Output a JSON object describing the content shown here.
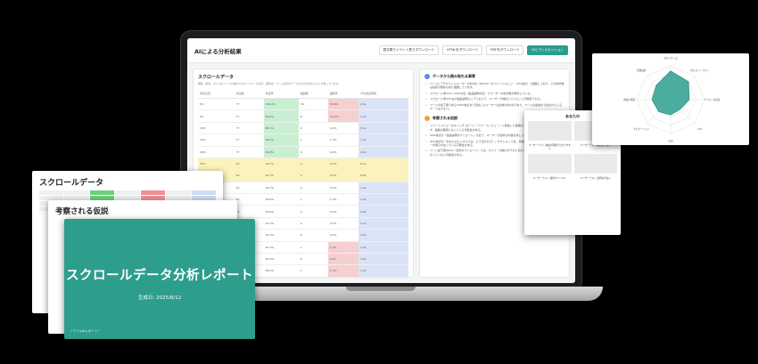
{
  "app": {
    "title": "AIによる分析結果",
    "buttons": [
      {
        "label": "週次周りイベント表でダウンロード"
      },
      {
        "label": "HTMLをダウンロード"
      },
      {
        "label": "PDFをダウンロード"
      },
      {
        "label": "AIとディスカッション"
      }
    ]
  },
  "left_panel": {
    "title": "スクロールデータ",
    "subtitle": "概要、指標、ボトルポイントFV等のスクロールバーの表示、閲覧率、ページ表示率データからの比率をさらに分析しています。",
    "columns": [
      "到達位置",
      "到達数",
      "到達率",
      "離脱数",
      "離脱率",
      "平均滞在時間"
    ],
    "rows": [
      {
        "pos": "0%",
        "count": "77",
        "rate": "100.0%",
        "exit": "39",
        "exit_rate": "50.6%",
        "time": "4.5s",
        "rate_c": "g",
        "exit_c": "r",
        "hl": false
      },
      {
        "pos": "5%",
        "count": "77",
        "rate": "50.6%",
        "exit": "8",
        "exit_rate": "10.4%",
        "time": "2.1s",
        "rate_c": "g",
        "exit_c": "r",
        "hl": false
      },
      {
        "pos": "10%",
        "count": "77",
        "rate": "48.1%",
        "exit": "0",
        "exit_rate": "0.0%",
        "time": "5.1s",
        "rate_c": "g",
        "exit_c": "",
        "hl": false
      },
      {
        "pos": "15%",
        "count": "77",
        "rate": "48.1%",
        "exit": "1",
        "exit_rate": "1.3%",
        "time": "7.1s",
        "rate_c": "g",
        "exit_c": "",
        "hl": false
      },
      {
        "pos": "20%",
        "count": "77",
        "rate": "46.8%",
        "exit": "0",
        "exit_rate": "0.0%",
        "time": "4.2s",
        "rate_c": "g",
        "exit_c": "",
        "hl": false
      },
      {
        "pos": "25%",
        "count": "16",
        "rate": "44.7%",
        "exit": "0",
        "exit_rate": "0.7%",
        "time": "8.1s",
        "rate_c": "g",
        "exit_c": "",
        "hl": true
      },
      {
        "pos": "30%",
        "count": "16",
        "rate": "44.7%",
        "exit": "0",
        "exit_rate": "0.7%",
        "time": "8.8s",
        "rate_c": "g",
        "exit_c": "",
        "hl": true
      },
      {
        "pos": "35%",
        "count": "16",
        "rate": "44.7%",
        "exit": "0",
        "exit_rate": "0.0%",
        "time": "1.2s",
        "rate_c": "",
        "exit_c": "",
        "hl": false
      },
      {
        "pos": "40%",
        "count": "16",
        "rate": "43.6%",
        "exit": "1",
        "exit_rate": "1.3%",
        "time": "2.4s",
        "rate_c": "",
        "exit_c": "",
        "hl": false
      },
      {
        "pos": "45%",
        "count": "16",
        "rate": "43.6%",
        "exit": "0",
        "exit_rate": "0.0%",
        "time": "2.8s",
        "rate_c": "",
        "exit_c": "",
        "hl": false
      },
      {
        "pos": "50%",
        "count": "16",
        "rate": "42.3%",
        "exit": "0",
        "exit_rate": "0.0%",
        "time": "4.1s",
        "rate_c": "",
        "exit_c": "",
        "hl": false
      },
      {
        "pos": "55%",
        "count": "16",
        "rate": "42.3%",
        "exit": "0",
        "exit_rate": "0.0%",
        "time": "3.6s",
        "rate_c": "",
        "exit_c": "",
        "hl": false
      },
      {
        "pos": "60%",
        "count": "16",
        "rate": "40.3%",
        "exit": "1",
        "exit_rate": "1.3%",
        "time": "2.4s",
        "rate_c": "",
        "exit_c": "r",
        "hl": false
      },
      {
        "pos": "65%",
        "count": "16",
        "rate": "40.3%",
        "exit": "0",
        "exit_rate": "0.0%",
        "time": "1.9s",
        "rate_c": "",
        "exit_c": "r",
        "hl": false
      },
      {
        "pos": "70%",
        "count": "16",
        "rate": "38.4%",
        "exit": "1",
        "exit_rate": "1.3%",
        "time": "2.2s",
        "rate_c": "",
        "exit_c": "r",
        "hl": false
      },
      {
        "pos": "75%",
        "count": "16",
        "rate": "38.4%",
        "exit": "0",
        "exit_rate": "0.0%",
        "time": "2.0s",
        "rate_c": "",
        "exit_c": "",
        "hl": false
      }
    ]
  },
  "right_panel": {
    "section1": {
      "title": "データから読み取れる事実",
      "bullets": [
        "ページにアクセスしたユーザーの約3割（38.9%）がファーストビュー（0%地点）で離脱しており、その約半数は最初の数秒以内に離脱しています。",
        "スクロール率25%〜30%付近（製品説明付近）でユーザーの約半数が残存している。",
        "スクロール率20%台の製品説明エリアにおいて、ユーザーが熟読していることが確認できる。",
        "ページの最下部である100%地点まで到達したユーザーは全体の約3割であり、ページの最後まで読まれているケースは少ない。"
      ]
    },
    "section2": {
      "title": "考察される仮説",
      "bullets": [
        "ファーストビューのキャッチコピーと「ファーストビュー」に関連した画像が、訪問者の期待と一致しておらず、離脱の要因になっている可能性がある。",
        "20%地点の「製品説明ダウンロード」付近で、ユーザーが資料の内容を詳しく確認しようとしている。",
        "40%地点の「あなたのビジネスでは、どう活かせる？」セクションでは、具体的な事例が不足しており、ユーザーが関心を失っている可能性がある。",
        "ページ最下部のCTA（資料ダウンロード）では、オファーの魅力が十分に伝わっておらず、コンバージョンに繋がっていない可能性がある。"
      ]
    }
  },
  "slides": {
    "slide1_title": "スクロールデータ",
    "slide2_title": "考察される仮説",
    "slide3_title": "スクロールデータ分析レポート",
    "slide3_date": "生成日: 2025/8/12",
    "slide3_footer": "ノウフルAIレポート™"
  },
  "radar": {
    "labels": [
      "ボタンサイズ",
      "色のコントラスト",
      "テキスト可読性",
      "CTA",
      "余白",
      "ナビゲーション",
      "情報の階層",
      "画像品質"
    ],
    "values": [
      0.85,
      0.75,
      0.55,
      0.4,
      0.45,
      0.5,
      0.55,
      0.6
    ],
    "colors": {
      "fill": "#2d9d8c",
      "stroke": "#2d9d8c"
    }
  },
  "grid_card": {
    "title": "あなたの",
    "captions": [
      "ユーザーテスト 価格が明確で分かりやすい",
      "ユーザーテスト 事例が少ない",
      "ユーザーテスト 操作がシンプル",
      "ユーザーテスト 説明文が長い"
    ]
  },
  "colors": {
    "accent": "#2d9d8c",
    "highlight": "#fbf3bd",
    "good": "#c9efd2",
    "bad": "#f6cfd1"
  }
}
